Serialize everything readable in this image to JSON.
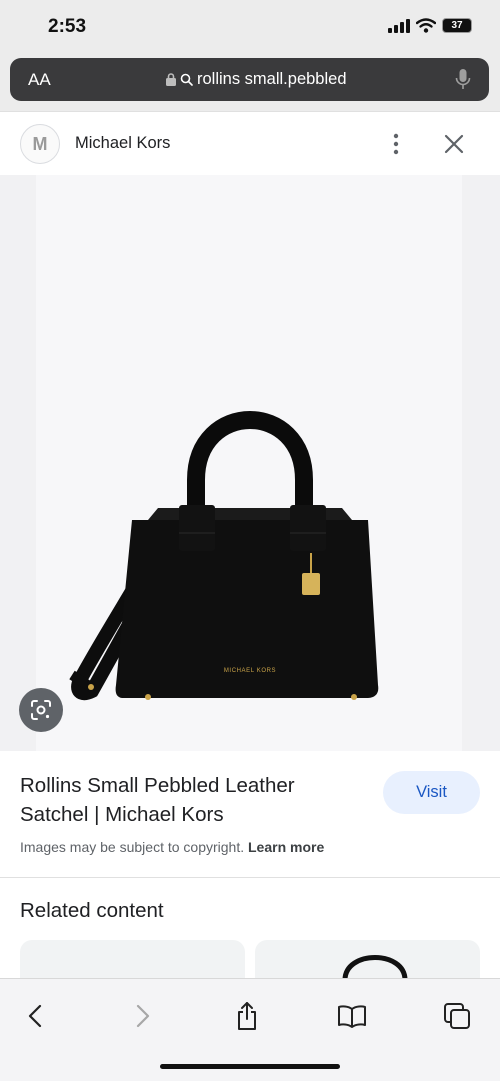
{
  "status": {
    "time": "2:53",
    "battery": "37"
  },
  "browser": {
    "aa_label": "AA",
    "url_text": "rollins small.pebbled"
  },
  "source": {
    "logo_letter": "M",
    "name": "Michael Kors"
  },
  "product": {
    "brand_stamp": "MICHAEL KORS",
    "title": "Rollins Small Pebbled Leather Satchel | Michael Kors",
    "visit_label": "Visit",
    "copyright_text": "Images may be subject to copyright.",
    "learn_more": "Learn more"
  },
  "related": {
    "heading": "Related content"
  },
  "icons": {
    "signal": "signal-icon",
    "wifi": "wifi-icon",
    "lock": "lock-icon",
    "search": "search-icon",
    "mic": "microphone-icon",
    "more": "more-vertical-icon",
    "close": "close-icon",
    "lens": "lens-icon",
    "back": "back-icon",
    "forward": "forward-icon",
    "share": "share-icon",
    "bookmarks": "bookmarks-icon",
    "tabs": "tabs-icon"
  },
  "colors": {
    "visit_bg": "#e8f0fe",
    "visit_text": "#1a57c3",
    "url_bar": "#3a3a3c"
  }
}
